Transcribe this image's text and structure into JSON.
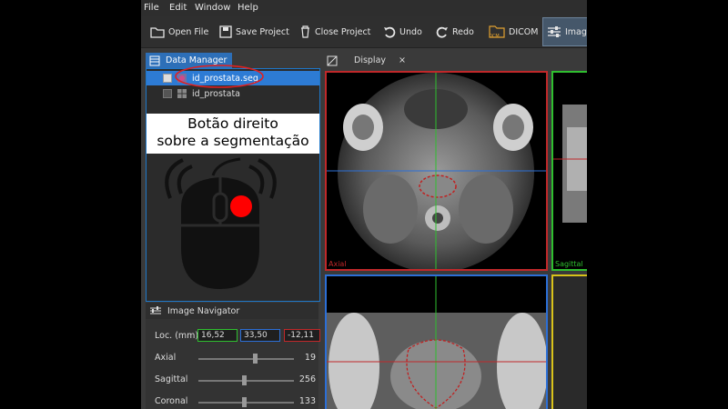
{
  "menu": [
    "File",
    "Edit",
    "Window",
    "Help"
  ],
  "toolbar": {
    "open_file": "Open File",
    "save_project": "Save Project",
    "close_project": "Close Project",
    "undo": "Undo",
    "redo": "Redo",
    "dicom": "DICOM",
    "dicom_badge": "DCM",
    "image": "Imag"
  },
  "data_manager": {
    "tab": "Data Manager",
    "nodes": [
      {
        "label": "id_prostata.seg",
        "selected": true
      },
      {
        "label": "id_prostata",
        "selected": false
      }
    ]
  },
  "callout": {
    "line1": "Botão direito",
    "line2": "sobre a segmentação"
  },
  "display": {
    "tab": "Display",
    "close": "×",
    "views": {
      "axial_label": "Axial",
      "sagittal_label": "Sagittal"
    }
  },
  "navigator": {
    "title": "Image Navigator",
    "loc_label": "Loc. (mm)",
    "loc_x": "16,52",
    "loc_y": "33,50",
    "loc_z": "-12,11",
    "rows": [
      {
        "label": "Axial",
        "value": "19"
      },
      {
        "label": "Sagittal",
        "value": "256"
      },
      {
        "label": "Coronal",
        "value": "133"
      }
    ]
  },
  "colors": {
    "accent": "#2d7bd4",
    "axial_border": "#c0282a",
    "sagittal_border": "#2fbf2f",
    "coronal_border": "#2c6fd6",
    "threeD_border": "#d8c21a",
    "pointer": "#ff0000"
  }
}
